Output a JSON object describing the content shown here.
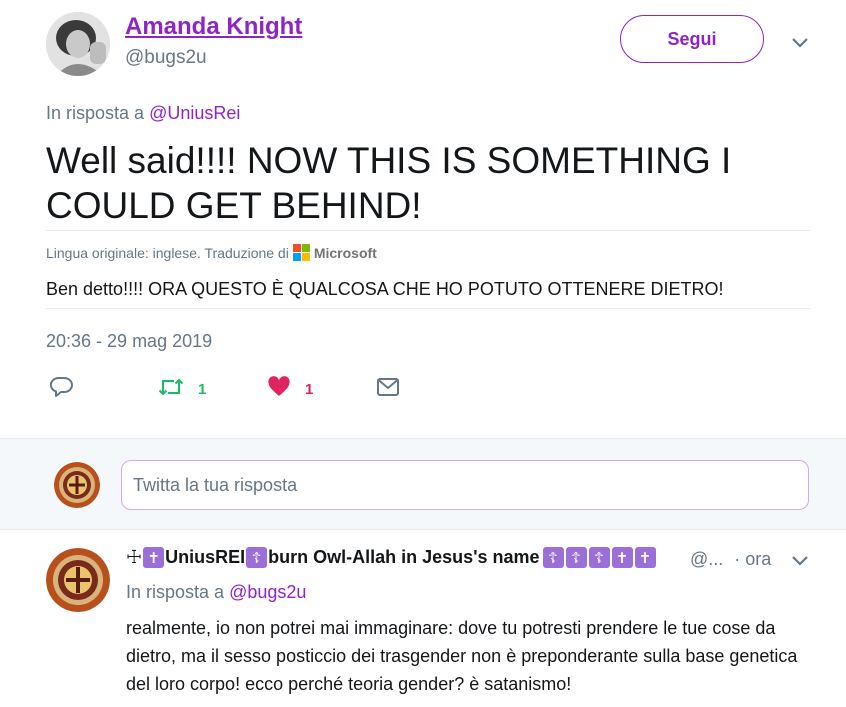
{
  "tweet": {
    "author_name": "Amanda Knight",
    "author_handle": "@bugs2u",
    "follow_label": "Segui",
    "reply_prefix": "In risposta a",
    "reply_to": "@UniusRei",
    "text": "Well said!!!! NOW THIS IS SOMETHING I COULD GET BEHIND!",
    "translation_note": "Lingua originale: inglese. Traduzione di",
    "translator": "Microsoft",
    "translated_text": "Ben detto!!!! ORA QUESTO È QUALCOSA CHE HO POTUTO OTTENERE DIETRO!",
    "timestamp": "20:36 - 29 mag 2019",
    "retweet_count": "1",
    "like_count": "1"
  },
  "compose": {
    "placeholder": "Twitta la tua risposta"
  },
  "reply": {
    "prefix_symbol": "☩",
    "author_name_part1": "UniusREI",
    "author_name_part2": "burn Owl-Allah in Jesus's name",
    "handle_truncated": "@...",
    "time": "· ora",
    "reply_prefix": "In risposta a",
    "reply_to": "@bugs2u",
    "text": "realmente, io non potrei mai immaginare: dove tu potresti prendere le tue cose da dietro, ma il sesso posticcio dei trasgender non è preponderante sulla base genetica del loro corpo! ecco perché teoria gender? è satanismo!"
  },
  "colors": {
    "accent": "#8e24c8",
    "retweet": "#17bf63",
    "like": "#e0245e",
    "secondary_text": "#657786"
  },
  "icons": [
    "reply-icon",
    "retweet-icon",
    "heart-icon",
    "message-icon",
    "chevron-down-icon",
    "microsoft-logo"
  ]
}
